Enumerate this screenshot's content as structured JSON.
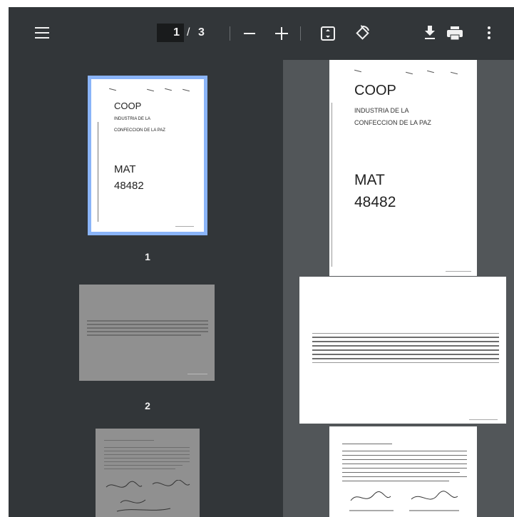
{
  "toolbar": {
    "current_page": "1",
    "page_separator": "/",
    "total_pages": "3"
  },
  "thumbnails": [
    {
      "label": "1"
    },
    {
      "label": "2"
    }
  ],
  "document": {
    "coop": "COOP",
    "line1": "INDUSTRIA DE LA",
    "line2": "CONFECCION DE LA PAZ",
    "mat": "MAT",
    "mat_number": "48482"
  }
}
